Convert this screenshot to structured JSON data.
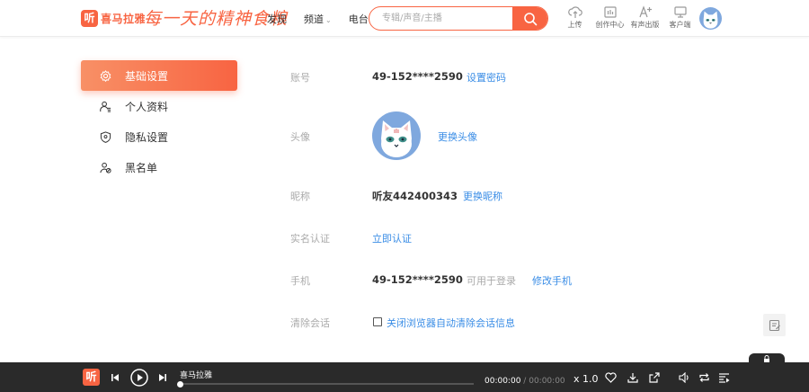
{
  "header": {
    "logo_glyph": "听",
    "logo_text": "喜马拉雅",
    "slogan": "每一天的精神食粮",
    "nav": [
      {
        "label": "发现"
      },
      {
        "label": "频道"
      },
      {
        "label": "电台"
      }
    ],
    "search_placeholder": "专辑/声音/主播",
    "tools": [
      {
        "label": "上传",
        "icon": "upload-icon"
      },
      {
        "label": "创作中心",
        "icon": "creator-icon"
      },
      {
        "label": "有声出版",
        "icon": "publish-icon"
      },
      {
        "label": "客户端",
        "icon": "client-icon"
      }
    ]
  },
  "sidebar": {
    "items": [
      {
        "label": "基础设置",
        "icon": "gear-icon",
        "active": true
      },
      {
        "label": "个人资料",
        "icon": "profile-icon",
        "active": false
      },
      {
        "label": "隐私设置",
        "icon": "shield-icon",
        "active": false
      },
      {
        "label": "黑名单",
        "icon": "blacklist-icon",
        "active": false
      }
    ]
  },
  "account": {
    "label": "账号",
    "value": "49-152****2590",
    "action": "设置密码"
  },
  "avatar": {
    "label": "头像",
    "action": "更换头像"
  },
  "nickname": {
    "label": "昵称",
    "value": "听友442400343",
    "action": "更换昵称"
  },
  "verify": {
    "label": "实名认证",
    "action": "立即认证"
  },
  "phone": {
    "label": "手机",
    "value": "49-152****2590",
    "hint": "可用于登录",
    "action": "修改手机"
  },
  "session": {
    "label": "清除会话",
    "checkbox_label": "关闭浏览器自动清除会话信息",
    "checked": false
  },
  "player": {
    "logo_glyph": "听",
    "title": "喜马拉雅",
    "current_time": "00:00:00",
    "separator": "/",
    "total_time": "00:00:00",
    "speed": "x 1.0",
    "progress": 0
  },
  "colors": {
    "brand": "#f86442",
    "link": "#3a8de6",
    "player_bg": "#2a2a2a"
  }
}
